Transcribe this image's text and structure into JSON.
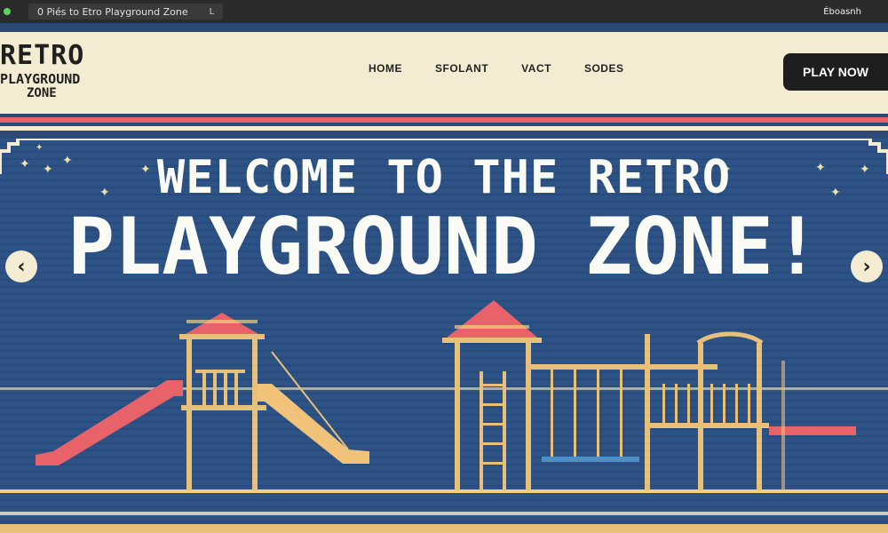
{
  "browser": {
    "tab_title": "0 Piés to  Etro Playground Zone",
    "tab_close": "L",
    "account": "Éboasnh"
  },
  "logo": {
    "line1": "RETRO",
    "line2": "PLAYGROUND",
    "line3": "ZONE"
  },
  "nav": {
    "items": [
      "HOME",
      "SFOLANT",
      "VACT",
      "SODES"
    ]
  },
  "cta": {
    "label": "PLAY NOW"
  },
  "hero": {
    "title_line1": "WELCOME TO THE RETRO",
    "title_line2": "PLAYGROUND ZONE!",
    "prev_icon": "chevron-left-icon",
    "next_icon": "chevron-right-icon"
  },
  "colors": {
    "header_bg": "#f4ecd2",
    "hero_bg": "#2d5286",
    "accent_red": "#e8626a",
    "wood": "#e8c07a",
    "button_bg": "#1e1e1e"
  }
}
